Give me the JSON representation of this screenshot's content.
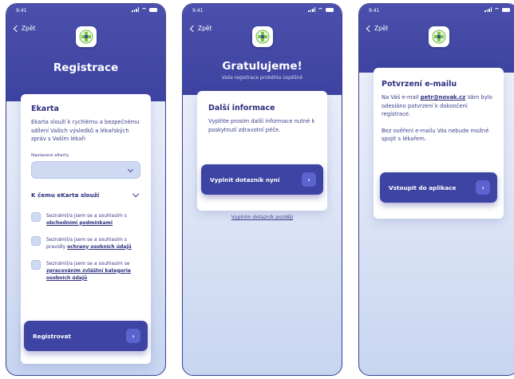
{
  "status": {
    "time": "9:41"
  },
  "back_label": "Zpět",
  "screen1": {
    "title": "Registrace",
    "card_title": "Ekarta",
    "card_text": "Ekarta slouží k rychlému a bezpečnému sdílení Vašich výsledků a lékařských zpráv s Vaším lékaři",
    "field_label": "Nastavení eKarty",
    "select_value": "",
    "section_label": "K čemu eKarta slouží",
    "checkboxes": [
      {
        "text": "Seznámil/a jsem se a souhlasím s",
        "link": "obchodními podmínkami",
        "checked": false
      },
      {
        "text": "Seznámil/a jsem se a souhlasím s pravidly",
        "link": "ochrany osobních údajů",
        "checked": false
      },
      {
        "text": "Seznámil/a jsem se a souhlasím se",
        "link": "zpracováním zvláštní kategorie osobních údajů",
        "checked": false
      }
    ],
    "button": "Registrovat",
    "arrow": "›"
  },
  "screen2": {
    "title": "Gratulujeme!",
    "subtitle": "Vaše registrace proběhla úspěšně",
    "card_title": "Další informace",
    "card_text": "Vyplňte prosím další informace nutné k poskytnutí zdravotní péče.",
    "button": "Vyplnit dotazník nyní",
    "arrow": "›",
    "later_link": "Vyplním dotazník později"
  },
  "screen3": {
    "card_title": "Potvrzení e-mailu",
    "text_before": "Na Váš e-mail",
    "email": "petr@novak.cz",
    "text_after": "Vám bylo odesláno potvrzení k dokončení registrace.",
    "text2": "Bez ověření e-mailu Vás nebude možné spojit s lékařem.",
    "button": "Vstoupit do aplikace",
    "arrow": "›"
  },
  "colors": {
    "primary": "#3d44a3",
    "header": "#4b50ac",
    "accent": "#5a63cf",
    "field": "#cfdaf2"
  },
  "icons": [
    "back-chevron-icon",
    "app-logo-icon",
    "chevron-down-icon",
    "arrow-right-icon",
    "signal-icon",
    "wifi-icon",
    "battery-icon"
  ]
}
